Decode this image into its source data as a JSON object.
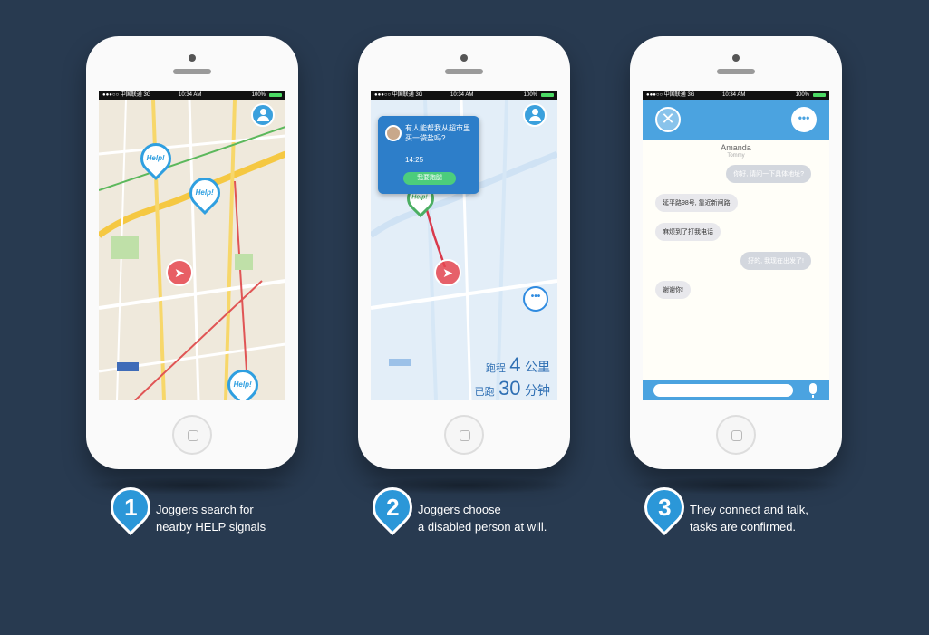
{
  "colors": {
    "background": "#283a50",
    "accent": "#2b97d8",
    "route": "#d93a4c",
    "confirm": "#4ccd7c"
  },
  "status_bar": {
    "carrier": "●●●○○ 中国联通 3G",
    "time": "10:34 AM",
    "battery": "100%"
  },
  "phone1": {
    "help_pins": [
      "Help!",
      "Help!",
      "Help!"
    ]
  },
  "phone2": {
    "popup": {
      "message": "有人能帮我从超市里买一袋盐吗?",
      "time": "14:25",
      "button": "我要跑腿"
    },
    "help_pin": "Help!",
    "stats": {
      "distance_label": "跑程",
      "distance_value": "4",
      "distance_unit": "公里",
      "run_label": "已跑",
      "run_value": "30",
      "run_unit": "分钟"
    }
  },
  "phone3": {
    "contact_name": "Amanda",
    "contact_sub": "Tommy",
    "messages": [
      {
        "side": "right",
        "text": "你好, 请问一下具体地址?"
      },
      {
        "side": "left",
        "text": "延平路98号, 靠近新闸路"
      },
      {
        "side": "left",
        "text": "麻烦到了打我电话"
      },
      {
        "side": "right",
        "text": "好的, 我现在出发了!"
      },
      {
        "side": "left",
        "text": "谢谢你!"
      }
    ]
  },
  "steps": [
    {
      "number": "1",
      "line1": "Joggers search for",
      "line2": "nearby HELP signals"
    },
    {
      "number": "2",
      "line1": "Joggers choose",
      "line2": "a disabled person at will."
    },
    {
      "number": "3",
      "line1": "They connect and talk,",
      "line2": "tasks are confirmed."
    }
  ]
}
